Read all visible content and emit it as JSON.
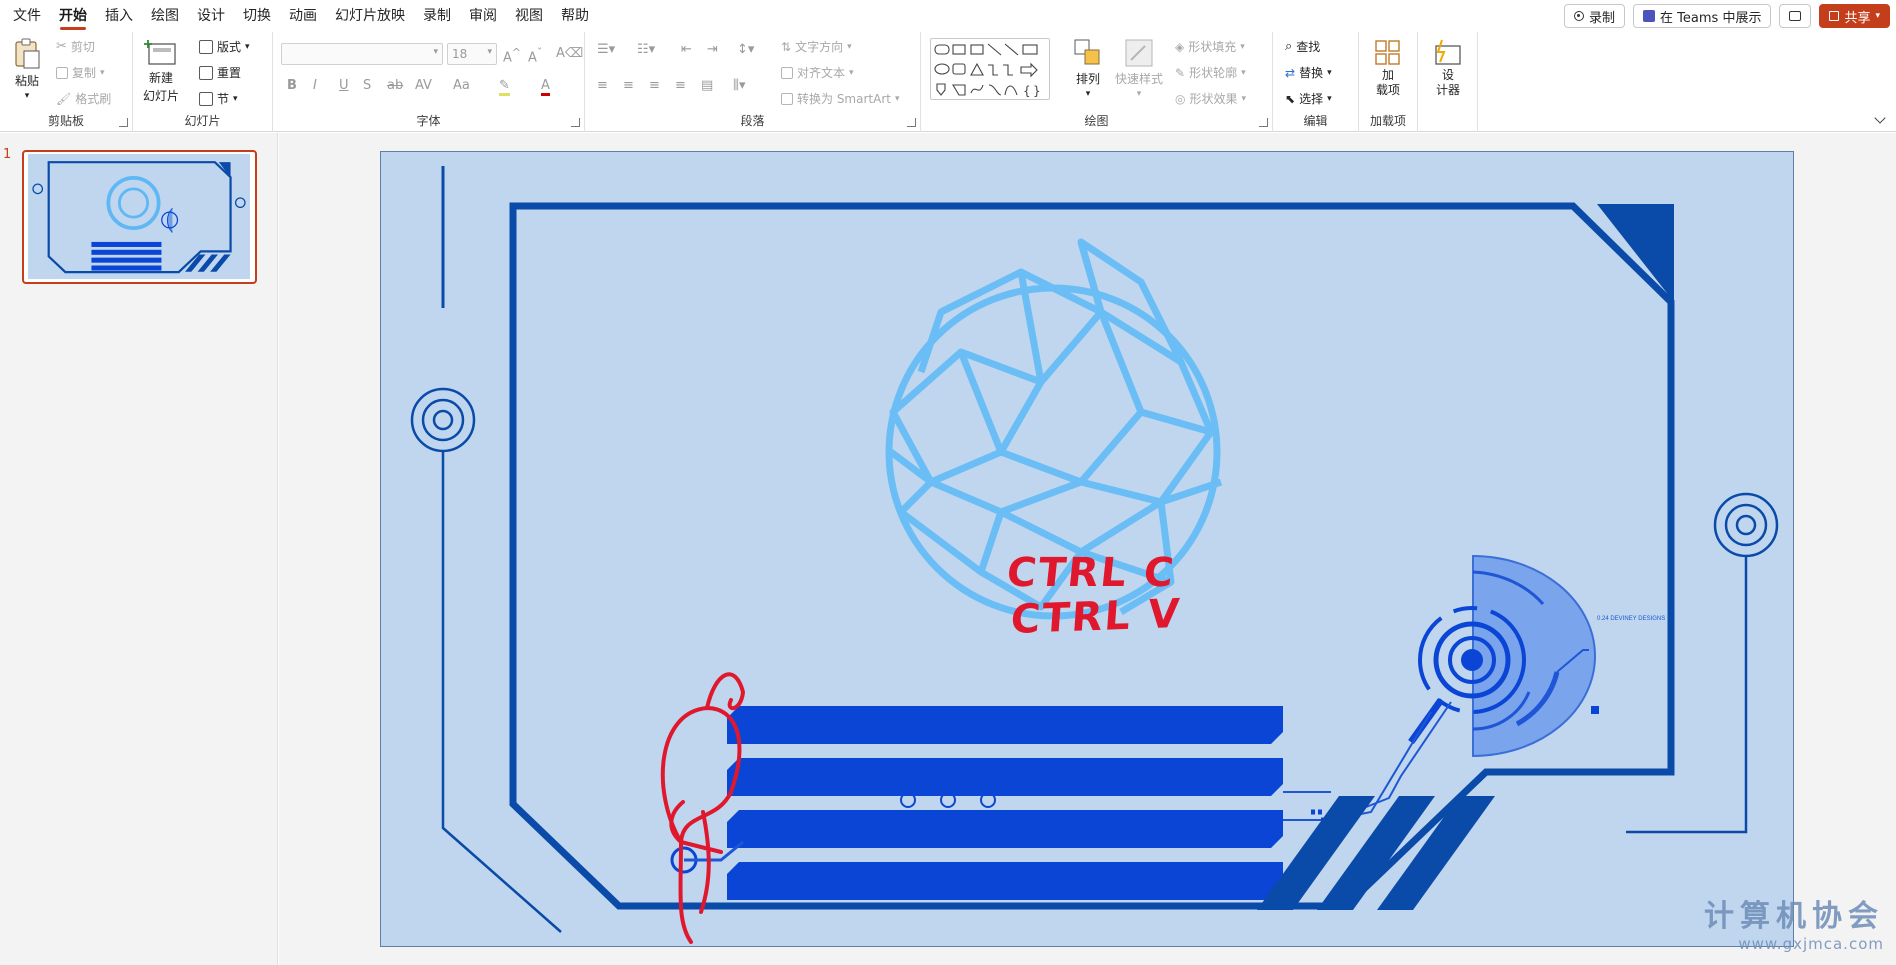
{
  "menu": {
    "tabs": [
      "文件",
      "开始",
      "插入",
      "绘图",
      "设计",
      "切换",
      "动画",
      "幻灯片放映",
      "录制",
      "审阅",
      "视图",
      "帮助"
    ],
    "active_tab": "开始"
  },
  "topbar": {
    "record": "录制",
    "teams": "在 Teams 中展示",
    "share": "共享"
  },
  "ribbon": {
    "clipboard": {
      "label": "剪贴板",
      "paste": "粘贴",
      "cut": "剪切",
      "copy": "复制",
      "format_painter": "格式刷"
    },
    "slides": {
      "label": "幻灯片",
      "new_slide": "新建",
      "new_slide2": "幻灯片",
      "layout": "版式",
      "reset": "重置",
      "section": "节"
    },
    "font": {
      "label": "字体",
      "font_size": "18"
    },
    "paragraph": {
      "label": "段落",
      "text_direction": "文字方向",
      "align_text": "对齐文本",
      "smartart": "转换为 SmartArt"
    },
    "drawing": {
      "label": "绘图",
      "arrange": "排列",
      "quick_styles": "快速样式",
      "shape_fill": "形状填充",
      "shape_outline": "形状轮廓",
      "shape_effects": "形状效果"
    },
    "editing": {
      "label": "编辑",
      "find": "查找",
      "replace": "替换",
      "select": "选择"
    },
    "addins": {
      "label": "加载项",
      "addins": "加载项",
      "addins_1": "加",
      "addins_2": "载项"
    },
    "designer": {
      "label1": "设",
      "label2": "计器"
    }
  },
  "slides_panel": {
    "slide_number": "1"
  },
  "slide": {
    "hud_caption": "0.24 DEVINEY DESIGNS",
    "ink_line1": "CTRL C",
    "ink_line2": "CTRL V"
  },
  "watermark": {
    "text": "计算机协会",
    "url": "www.gxjmca.com"
  },
  "colors": {
    "accent": "#c43e1c",
    "slide_bg": "#bfd6ee",
    "frame": "#0a4aa8",
    "bars": "#0b45d6",
    "ink": "#e0182d"
  }
}
